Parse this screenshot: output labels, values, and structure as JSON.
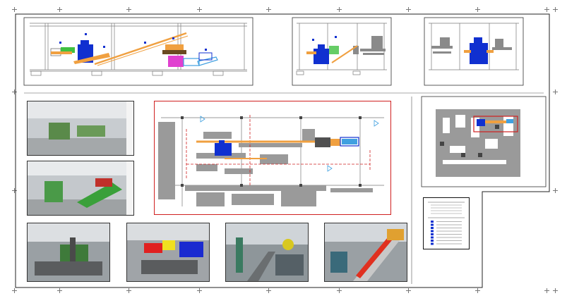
{
  "drawing": {
    "sheet_color": "#ffffff",
    "line_color": "#222222",
    "accent_colors": {
      "conveyor": "#f0a040",
      "equipment_blue": "#1030d0",
      "separator_green": "#40c040",
      "magenta": "#e040d0",
      "cyan": "#40a0e0",
      "highlight_red": "#d02020",
      "structure_gray": "#8a8a8a"
    }
  },
  "elevations": [
    {
      "id": "elevation-left",
      "label": ""
    },
    {
      "id": "elevation-middle",
      "label": ""
    },
    {
      "id": "elevation-right",
      "label": ""
    }
  ],
  "plan": {
    "label": ""
  },
  "site_plan": {
    "label": ""
  },
  "legend": {
    "title": "",
    "rows": 8
  },
  "photos": [
    {
      "id": "photo-1",
      "caption": ""
    },
    {
      "id": "photo-2",
      "caption": ""
    },
    {
      "id": "photo-3",
      "caption": ""
    },
    {
      "id": "photo-4",
      "caption": ""
    },
    {
      "id": "photo-5",
      "caption": ""
    },
    {
      "id": "photo-6",
      "caption": ""
    }
  ]
}
